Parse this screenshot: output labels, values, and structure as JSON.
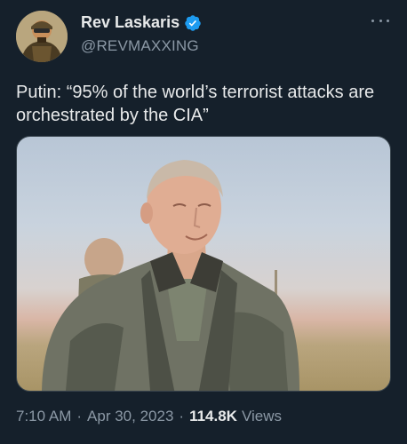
{
  "author": {
    "display_name": "Rev Laskaris",
    "handle": "@REVMAXXING",
    "verified": true,
    "avatar": "avatar"
  },
  "tweet": {
    "text": "Putin: “95% of the world’s terrorist attacks are orchestrated by the CIA”",
    "media": "photo"
  },
  "meta": {
    "time": "7:10 AM",
    "date": "Apr 30, 2023",
    "separator": "·",
    "views_count": "114.8K",
    "views_label": "Views"
  },
  "icons": {
    "more": "more-options-icon",
    "verified": "verified-badge-icon"
  },
  "colors": {
    "background": "#15202b",
    "verified": "#1d9bf0",
    "secondary_text": "#8b98a5"
  }
}
